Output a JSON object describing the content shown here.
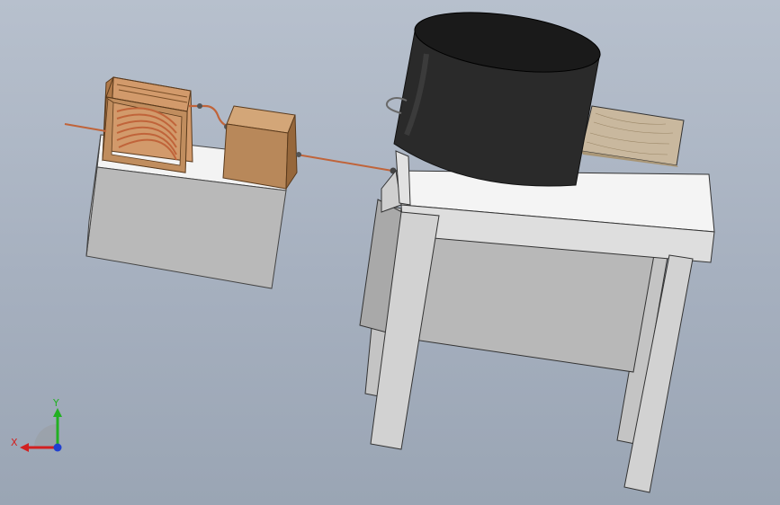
{
  "viewport": {
    "background_top": "#b7c0cd",
    "background_bottom": "#9aa5b4"
  },
  "colors": {
    "table_top": "#f4f4f4",
    "table_side": "#c9c9c9",
    "table_body": "#b4b4b4",
    "wood": "#b8885a",
    "wood_dark": "#8f6238",
    "copper": "#c8744a",
    "vessel": "#2b2b2b",
    "vessel_top": "#1d1d1d",
    "insulation": "#c9b79c"
  },
  "triad": {
    "x_label": "X",
    "y_label": "Y",
    "x_color": "#d22020",
    "y_color": "#22b022",
    "z_color": "#2040d0"
  }
}
